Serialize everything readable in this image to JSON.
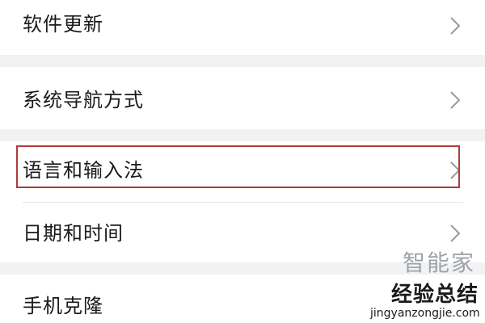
{
  "settings_list": {
    "items": [
      {
        "label": "软件更新"
      },
      {
        "label": "系统导航方式"
      },
      {
        "label": "语言和输入法"
      },
      {
        "label": "日期和时间"
      },
      {
        "label": "手机克隆"
      }
    ]
  },
  "watermark": {
    "logo": "智能家",
    "title": "经验总结",
    "url": "jingyanzongjie.com"
  },
  "colors": {
    "highlight": "#b03a3a",
    "section_gap": "#f2f2f2",
    "chevron": "#9a9a9a"
  },
  "icons": {
    "row_chevron": "chevron-right-icon"
  }
}
